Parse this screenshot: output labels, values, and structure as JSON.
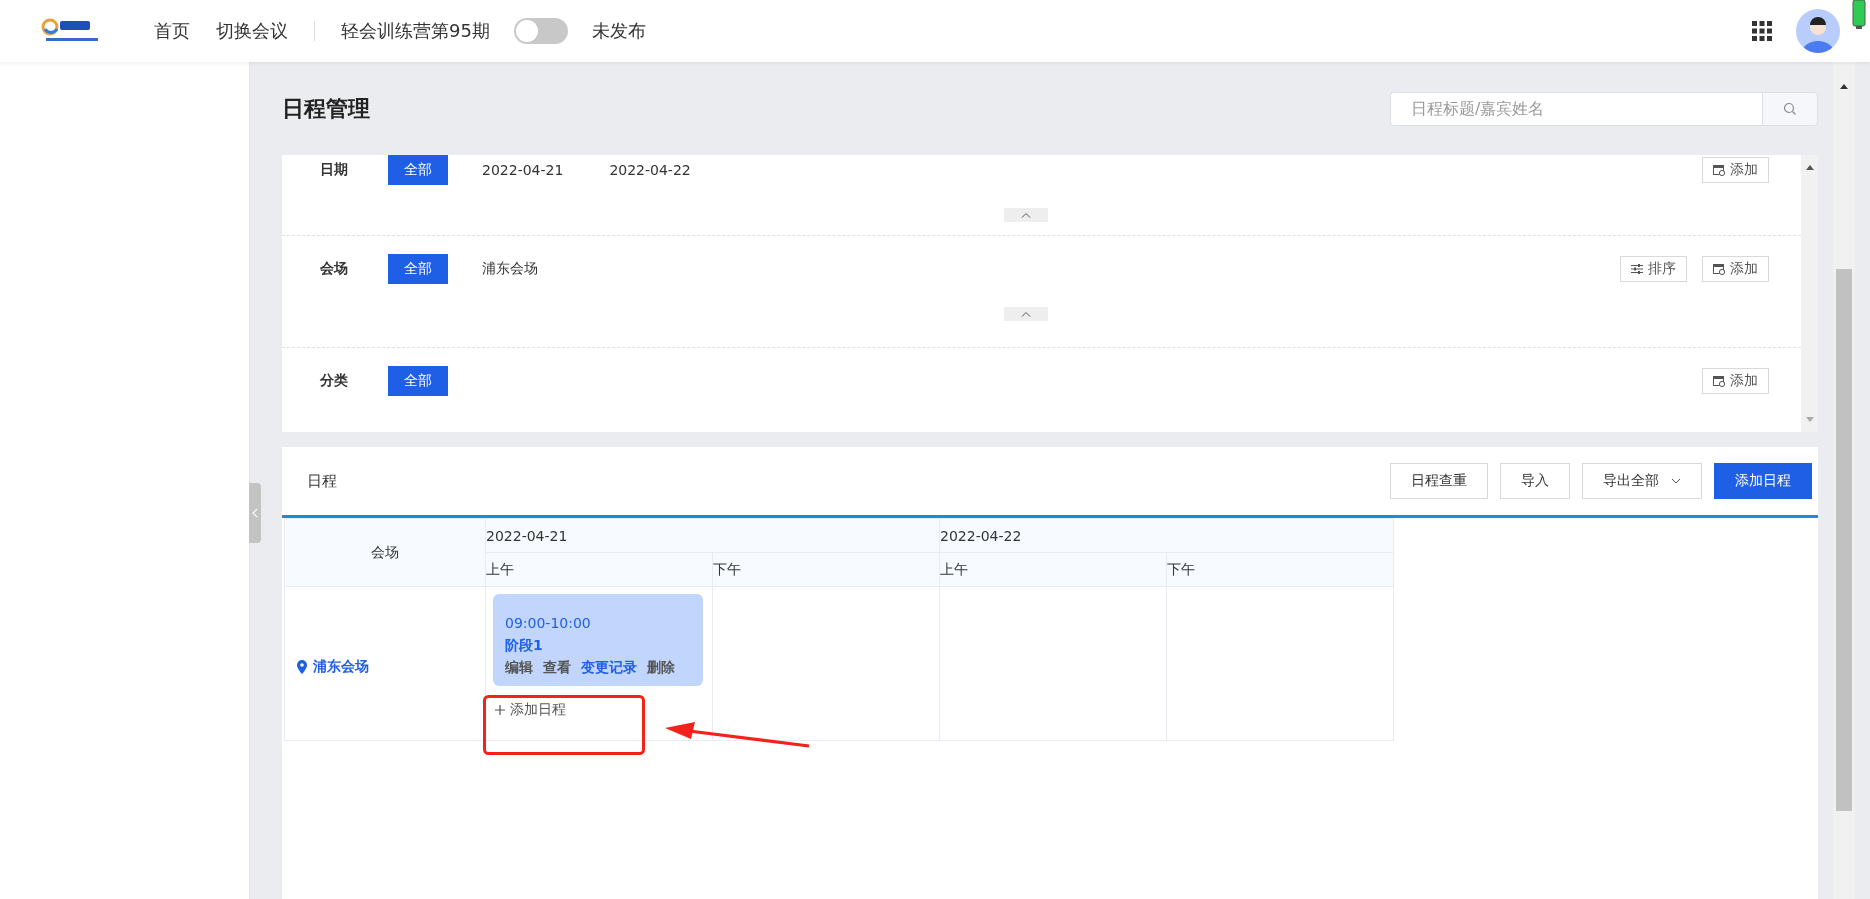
{
  "header": {
    "nav": [
      {
        "label": "首页"
      },
      {
        "label": "切换会议"
      }
    ],
    "meeting_title": "轻会训练营第95期",
    "publish_toggle": {
      "on": false
    },
    "publish_status": "未发布"
  },
  "page_title": "日程管理",
  "search": {
    "placeholder": "日程标题/嘉宾姓名"
  },
  "filters": [
    {
      "label": "日期",
      "collapsible": true,
      "options": [
        {
          "label": "全部",
          "selected": true
        },
        {
          "label": "2022-04-21",
          "selected": false
        },
        {
          "label": "2022-04-22",
          "selected": false
        }
      ],
      "actions": [
        {
          "label": "添加",
          "kind": "add"
        }
      ]
    },
    {
      "label": "会场",
      "collapsible": true,
      "options": [
        {
          "label": "全部",
          "selected": true
        },
        {
          "label": "浦东会场",
          "selected": false
        }
      ],
      "actions": [
        {
          "label": "排序",
          "kind": "sort"
        },
        {
          "label": "添加",
          "kind": "add"
        }
      ]
    },
    {
      "label": "分类",
      "collapsible": false,
      "options": [
        {
          "label": "全部",
          "selected": true
        }
      ],
      "actions": [
        {
          "label": "添加",
          "kind": "add"
        }
      ]
    }
  ],
  "schedule": {
    "title": "日程",
    "buttons": [
      {
        "label": "日程查重",
        "kind": "default"
      },
      {
        "label": "导入",
        "kind": "default"
      },
      {
        "label": "导出全部",
        "kind": "dropdown"
      },
      {
        "label": "添加日程",
        "kind": "primary"
      }
    ],
    "table": {
      "venue_header": "会场",
      "days": [
        {
          "date": "2022-04-21",
          "halves": [
            "上午",
            "下午"
          ]
        },
        {
          "date": "2022-04-22",
          "halves": [
            "上午",
            "下午"
          ]
        }
      ],
      "rows": [
        {
          "venue": "浦东会场",
          "cells": [
            {
              "events": [
                {
                  "time": "09:00-10:00",
                  "title": "阶段1",
                  "actions": [
                    {
                      "label": "编辑",
                      "kind": "plain"
                    },
                    {
                      "label": "查看",
                      "kind": "plain"
                    },
                    {
                      "label": "变更记录",
                      "kind": "link"
                    },
                    {
                      "label": "删除",
                      "kind": "plain"
                    }
                  ]
                }
              ],
              "add_label": "添加日程"
            }
          ]
        }
      ]
    }
  }
}
